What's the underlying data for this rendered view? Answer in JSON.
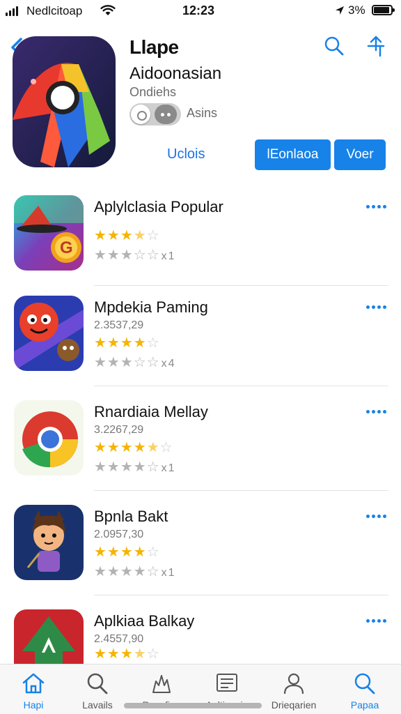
{
  "status_bar": {
    "carrier": "Nedlcitoap",
    "time": "12:23",
    "battery": "3%"
  },
  "header": {
    "app_name": "Llape",
    "subtitle": "Aidoonasian",
    "category": "Ondiehs",
    "toggle_label": "Asins",
    "link_label": "Uclois",
    "primary_button": "lEonlaoa",
    "secondary_button": "Voer"
  },
  "apps": [
    {
      "title": "Aplylclasia Popular",
      "meta": "",
      "rating": 3.5,
      "count": "1"
    },
    {
      "title": "Mpdekia Paming",
      "meta": "2.3537,29",
      "rating": 3.5,
      "count": "4"
    },
    {
      "title": "Rnardiaia Mellay",
      "meta": "3.2267,29",
      "rating": 4.5,
      "count": "1"
    },
    {
      "title": "Bpnla Bakt",
      "meta": "2.0957,30",
      "rating": 4,
      "count": "1"
    },
    {
      "title": "Aplkiaa Balkay",
      "meta": "2.4557,90",
      "rating": 3.5,
      "count": ""
    }
  ],
  "tabs": [
    {
      "label": "Hapi",
      "icon": "home-icon",
      "active": true
    },
    {
      "label": "Lavails",
      "icon": "search-icon",
      "active": false
    },
    {
      "label": "Rnecfinn",
      "icon": "games-icon",
      "active": false
    },
    {
      "label": "Aeltinesia",
      "icon": "list-icon",
      "active": false
    },
    {
      "label": "Drieqarien",
      "icon": "person-icon",
      "active": false
    },
    {
      "label": "Papaa",
      "icon": "search-icon",
      "active": true
    }
  ],
  "colors": {
    "accent": "#1782e8",
    "star": "#f5b400",
    "star_off": "#c9c9c9"
  }
}
